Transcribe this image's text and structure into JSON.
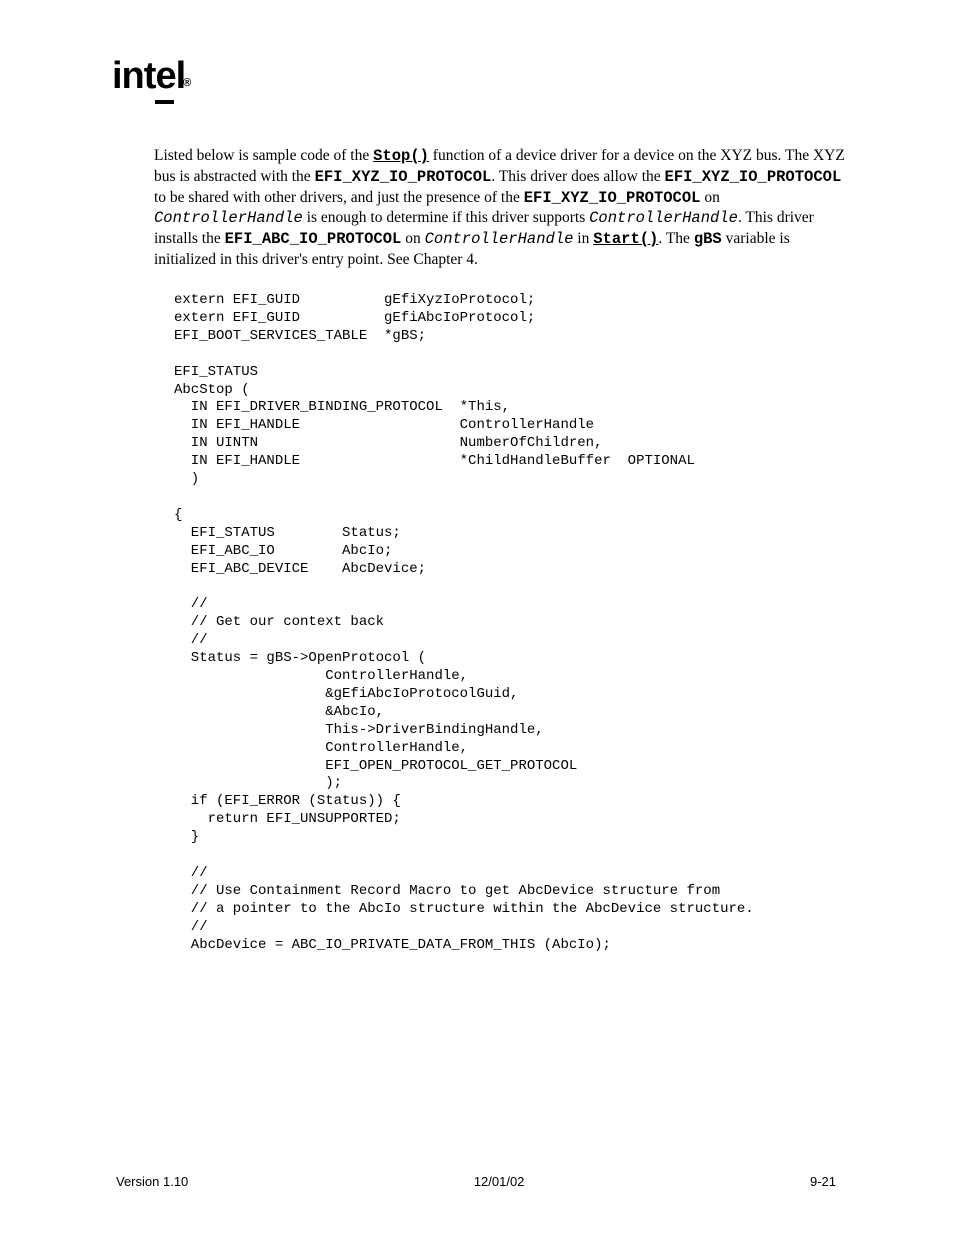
{
  "logo": "intel",
  "paragraph": {
    "t1": "Listed below is sample code of the ",
    "stop": "Stop()",
    "t2": " function of a device driver for a device on the XYZ bus.  The XYZ bus is abstracted with the ",
    "xyz1": "EFI_XYZ_IO_PROTOCOL",
    "t3": ".  This driver does allow the ",
    "xyz2": "EFI_XYZ_IO_PROTOCOL",
    "t4": " to be shared with other drivers, and just the presence of the ",
    "xyz3": "EFI_XYZ_IO_PROTOCOL",
    "t5": " on ",
    "ch1": "ControllerHandle",
    "t6": " is enough to determine if this driver supports ",
    "ch2": "ControllerHandle",
    "t7": ".  This driver installs the ",
    "abc": "EFI_ABC_IO_PROTOCOL",
    "t8": " on ",
    "ch3": "ControllerHandle",
    "t9": " in ",
    "start": "Start()",
    "t10": ".  The ",
    "gbs": "gBS",
    "t11": " variable is initialized in this driver's entry point.  See Chapter 4."
  },
  "code": "extern EFI_GUID          gEfiXyzIoProtocol;\nextern EFI_GUID          gEfiAbcIoProtocol;\nEFI_BOOT_SERVICES_TABLE  *gBS;\n\nEFI_STATUS\nAbcStop (\n  IN EFI_DRIVER_BINDING_PROTOCOL  *This,\n  IN EFI_HANDLE                   ControllerHandle\n  IN UINTN                        NumberOfChildren,\n  IN EFI_HANDLE                   *ChildHandleBuffer  OPTIONAL\n  )\n\n{\n  EFI_STATUS        Status;\n  EFI_ABC_IO        AbcIo;\n  EFI_ABC_DEVICE    AbcDevice;\n\n  //\n  // Get our context back\n  //\n  Status = gBS->OpenProtocol (\n                  ControllerHandle,\n                  &gEfiAbcIoProtocolGuid,\n                  &AbcIo,\n                  This->DriverBindingHandle,\n                  ControllerHandle,\n                  EFI_OPEN_PROTOCOL_GET_PROTOCOL\n                  );\n  if (EFI_ERROR (Status)) {\n    return EFI_UNSUPPORTED;\n  }\n\n  //\n  // Use Containment Record Macro to get AbcDevice structure from\n  // a pointer to the AbcIo structure within the AbcDevice structure.\n  //\n  AbcDevice = ABC_IO_PRIVATE_DATA_FROM_THIS (AbcIo);",
  "footer": {
    "version": "Version 1.10",
    "date": "12/01/02",
    "page": "9-21"
  }
}
